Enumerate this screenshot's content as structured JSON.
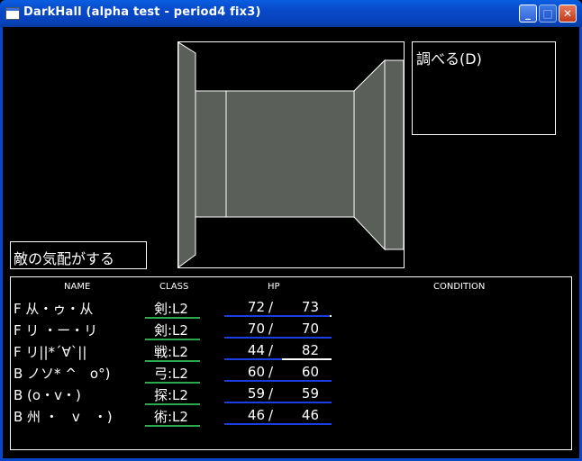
{
  "window": {
    "title": "DarkHall (alpha test - period4 fix3)",
    "min_glyph": "_",
    "max_glyph": "□",
    "close_glyph": "✕"
  },
  "command": {
    "examine_label": "調べる(D)"
  },
  "message": {
    "text": "敵の気配がする"
  },
  "party": {
    "headers": {
      "name": "NAME",
      "class": "CLASS",
      "hp": "HP",
      "condition": "CONDITION"
    },
    "members": [
      {
        "name": "F 从・ゥ・从",
        "class": "剣:L2",
        "hp": 72,
        "hp_max": 73,
        "hp_fraction": 0.986,
        "condition": ""
      },
      {
        "name": "F リ ・ー・リ",
        "class": "剣:L2",
        "hp": 70,
        "hp_max": 70,
        "hp_fraction": 1.0,
        "condition": ""
      },
      {
        "name": "F リ||*´∀`||",
        "class": "戦:L2",
        "hp": 44,
        "hp_max": 82,
        "hp_fraction": 0.537,
        "condition": ""
      },
      {
        "name": "B ノソ* ^　o°)",
        "class": "弓:L2",
        "hp": 60,
        "hp_max": 60,
        "hp_fraction": 1.0,
        "condition": ""
      },
      {
        "name": "B (o・v・)",
        "class": "探:L2",
        "hp": 59,
        "hp_max": 59,
        "hp_fraction": 1.0,
        "condition": ""
      },
      {
        "name": "B 州 ・　v　・)",
        "class": "術:L2",
        "hp": 46,
        "hp_max": 46,
        "hp_fraction": 1.0,
        "condition": ""
      }
    ],
    "hp_separator": "/",
    "colors": {
      "class_bar": "#2aa84a",
      "hp_fill": "#1a3fe0",
      "hp_empty": "#ffffff"
    }
  },
  "dungeon": {
    "view": "corridor-forward",
    "wall_color": "#5a5f5a"
  }
}
